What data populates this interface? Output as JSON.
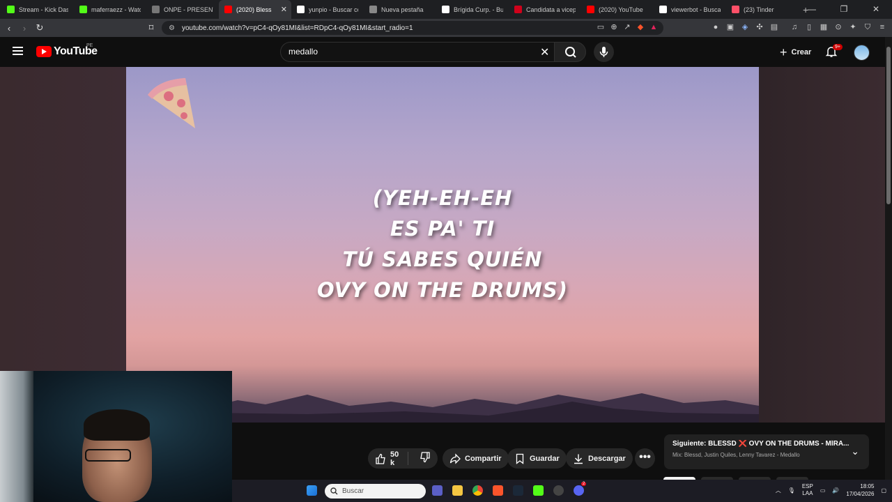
{
  "browser": {
    "tabs": [
      {
        "label": "Stream - Kick Dashb",
        "favicon": "kick-icon",
        "color": "#53fc18",
        "active": false
      },
      {
        "label": "maferraezz - Watch",
        "favicon": "kick-icon",
        "color": "#53fc18",
        "active": false
      },
      {
        "label": "ONPE - PRESENTAC",
        "favicon": "onpe-icon",
        "color": "#777777",
        "active": false
      },
      {
        "label": "(2020) Bless",
        "favicon": "youtube-icon",
        "color": "#ff0000",
        "active": true
      },
      {
        "label": "yunpio - Buscar con",
        "favicon": "google-icon",
        "color": "#ffffff",
        "active": false
      },
      {
        "label": "Nueva pestaña",
        "favicon": "brave-shield-icon",
        "color": "#888888",
        "active": false
      },
      {
        "label": "Brígida Curp. - Busc",
        "favicon": "google-icon",
        "color": "#ffffff",
        "active": false
      },
      {
        "label": "Candidata a vicepre",
        "favicon": "lr-icon",
        "color": "#d0021b",
        "active": false
      },
      {
        "label": "(2020) YouTube",
        "favicon": "youtube-icon",
        "color": "#ff0000",
        "active": false
      },
      {
        "label": "viewerbot - Buscar c",
        "favicon": "google-icon",
        "color": "#ffffff",
        "active": false
      },
      {
        "label": "(23) Tinder",
        "favicon": "tinder-icon",
        "color": "#fd5068",
        "active": false
      }
    ],
    "url": "youtube.com/watch?v=pC4-qOy81MI&list=RDpC4-qOy81MI&start_radio=1"
  },
  "youtube": {
    "logo_text": "YouTube",
    "country_code": "PE",
    "search_value": "medallo",
    "create_label": "Crear",
    "notif_badge": "9+"
  },
  "video": {
    "lyrics": [
      "(YEH-EH-EH",
      "ES PA' TI",
      "TÚ SABES QUIÉN",
      "OVY ON THE DRUMS)"
    ]
  },
  "actions": {
    "likes": "50 k",
    "share": "Compartir",
    "save": "Guardar",
    "download": "Descargar",
    "more": "•••"
  },
  "next": {
    "title": "Siguiente: BLESSD ❌ OVY ON THE DRUMS - MÍRA...",
    "subtitle": "Mix: Blessd, Justin Quiles, Lenny Tavarez - Medallo"
  },
  "taskbar": {
    "search_placeholder": "Buscar",
    "lang": "ESP",
    "layout": "LAA",
    "time": "18:05",
    "date": "17/04/2026",
    "discord_badge": "2"
  }
}
